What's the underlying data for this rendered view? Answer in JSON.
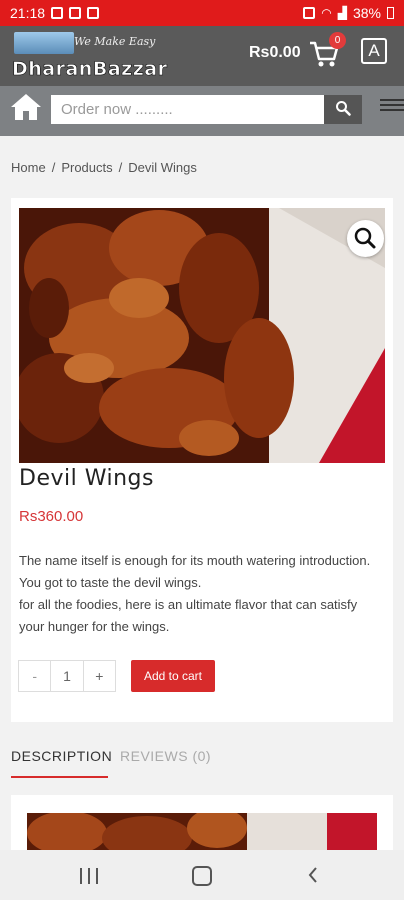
{
  "status_bar": {
    "time": "21:18",
    "battery": "38%"
  },
  "header": {
    "brand_name": "DharanBazzar",
    "tagline": "We Make Easy",
    "cart_total": "Rs0.00",
    "cart_count": "0",
    "account_icon": "A"
  },
  "search": {
    "placeholder": "Order now .........",
    "value": ""
  },
  "breadcrumb": {
    "items": [
      "Home",
      "Products",
      "Devil Wings"
    ]
  },
  "product": {
    "title": "Devil Wings",
    "price": "Rs360.00",
    "description": [
      "The name itself is enough for its mouth watering introduction. You got to taste the devil wings.",
      "for all the foodies, here is an ultimate flavor that can satisfy your hunger for the wings."
    ],
    "quantity": "1",
    "minus_label": "-",
    "plus_label": "+",
    "add_to_cart_label": "Add to cart"
  },
  "tabs": {
    "description": "DESCRIPTION",
    "reviews": "REVIEWS (0)"
  },
  "colors": {
    "status_bar": "#e01b1b",
    "header": "#5a5a5a",
    "accent": "#d72b2b"
  }
}
